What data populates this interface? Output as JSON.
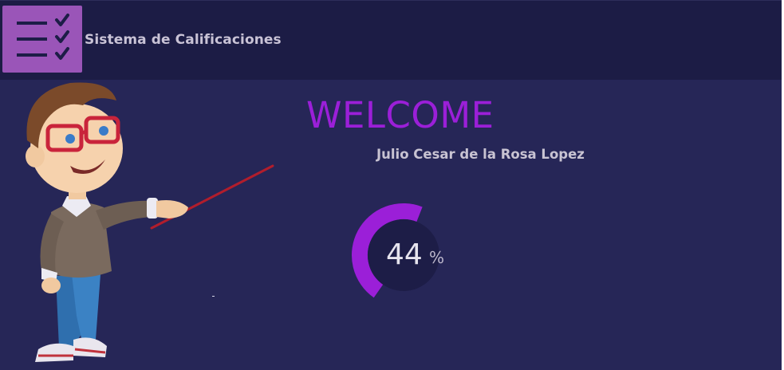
{
  "header": {
    "app_title": "Sistema de Calificaciones",
    "logo_icon": "checklist-icon"
  },
  "main": {
    "welcome_text": "WELCOME",
    "user_name": "Julio Cesar de la Rosa Lopez",
    "progress": {
      "value": "44",
      "unit": "%",
      "percent": 44
    },
    "illustration": "teacher-with-pointer-illustration"
  },
  "colors": {
    "header_bg": "#1c1c45",
    "main_bg": "#262657",
    "logo_bg": "#9a55b8",
    "accent": "#9b1fd8",
    "gauge_inner": "#1d1d47",
    "text_light": "#c9c3d6"
  }
}
